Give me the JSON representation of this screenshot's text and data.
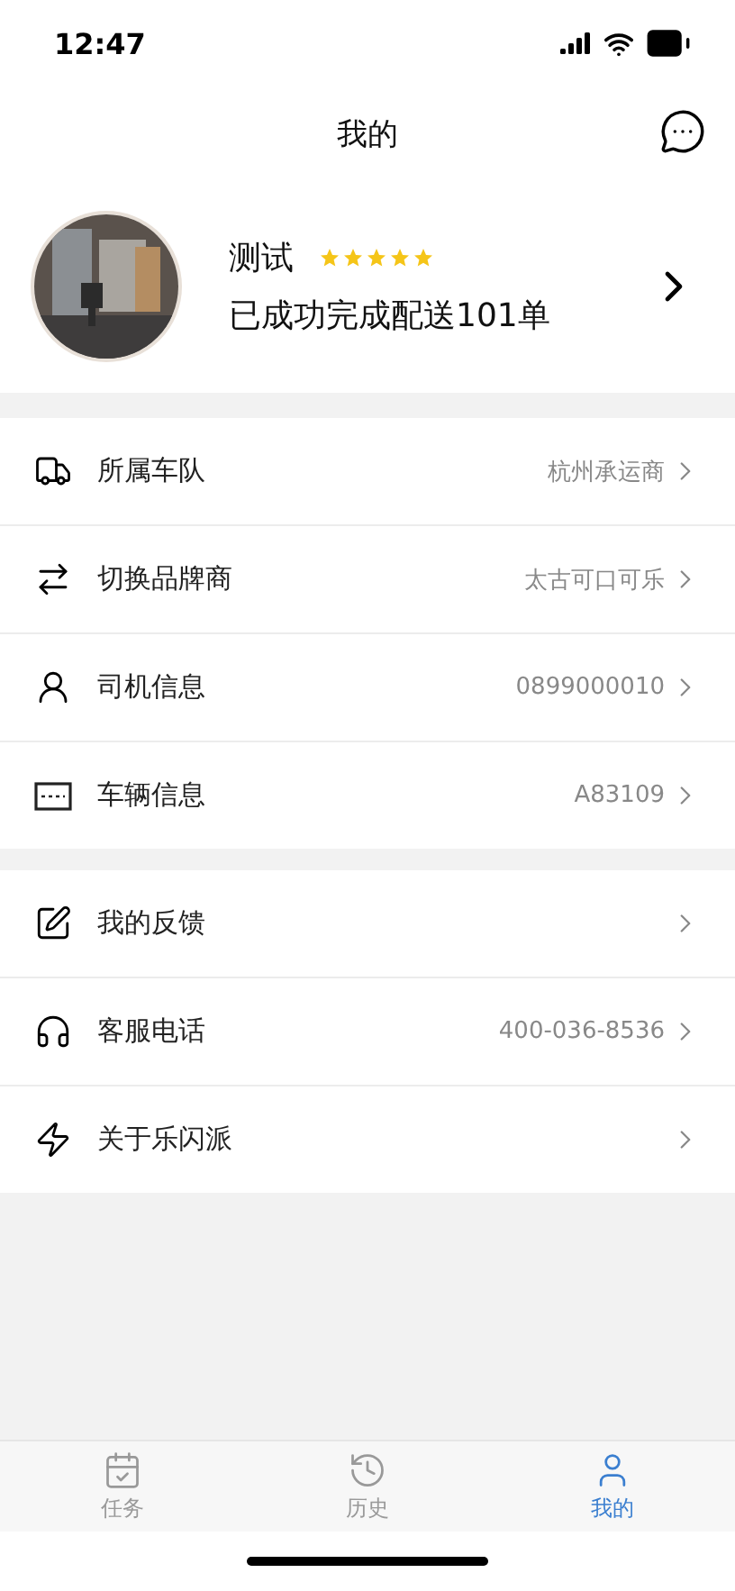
{
  "status_bar": {
    "time": "12:47"
  },
  "nav": {
    "title": "我的"
  },
  "profile": {
    "name": "测试",
    "stars": 5,
    "summary": "已成功完成配送101单"
  },
  "groups": [
    {
      "rows": [
        {
          "label": "所属车队",
          "value": "杭州承运商"
        },
        {
          "label": "切换品牌商",
          "value": "太古可口可乐"
        },
        {
          "label": "司机信息",
          "value": "0899000010"
        },
        {
          "label": "车辆信息",
          "value": "A83109"
        }
      ]
    },
    {
      "rows": [
        {
          "label": "我的反馈"
        },
        {
          "label": "客服电话",
          "value": "400-036-8536"
        },
        {
          "label": "关于乐闪派"
        }
      ]
    }
  ],
  "tabs": [
    {
      "label": "任务",
      "selected": false
    },
    {
      "label": "历史",
      "selected": false
    },
    {
      "label": "我的",
      "selected": true
    }
  ]
}
